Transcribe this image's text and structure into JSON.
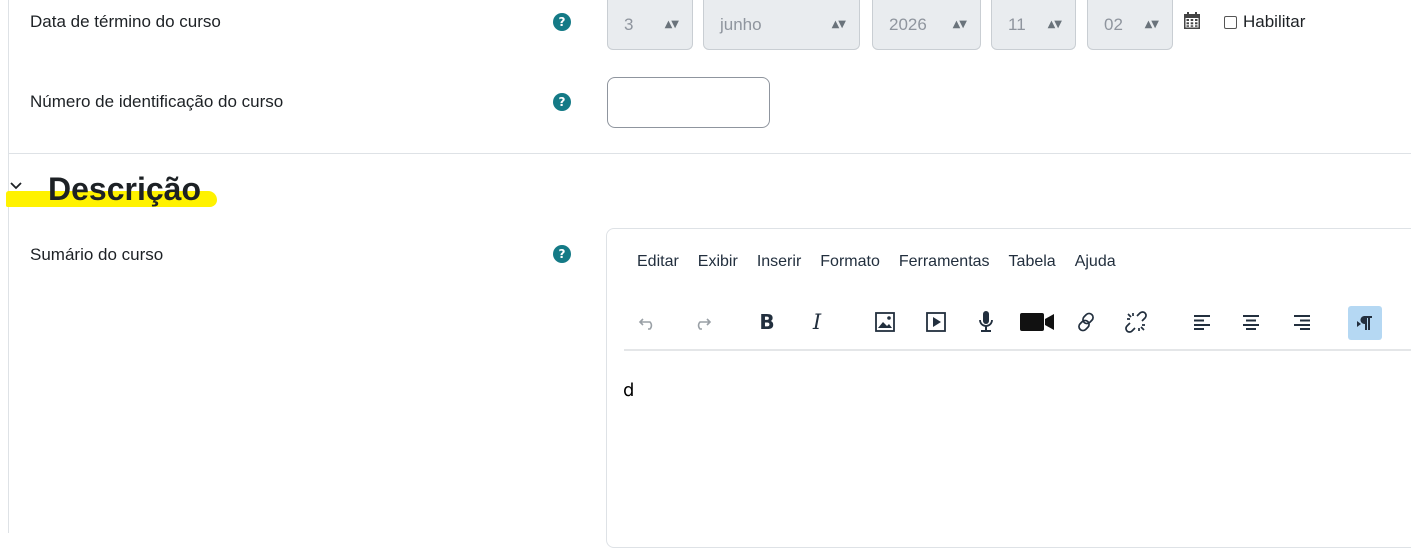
{
  "fields": {
    "end_date_label": "Data de término do curso",
    "end_date": {
      "day": "3",
      "month": "junho",
      "year": "2026",
      "hour": "11",
      "minute": "02",
      "enable_label": "Habilitar",
      "enabled": false
    },
    "idnumber_label": "Número de identificação do curso",
    "idnumber_value": ""
  },
  "section": {
    "title": "Descrição",
    "summary_label": "Sumário do curso"
  },
  "editor": {
    "menus": [
      "Editar",
      "Exibir",
      "Inserir",
      "Formato",
      "Ferramentas",
      "Tabela",
      "Ajuda"
    ],
    "toolbar": [
      "undo-icon",
      "redo-icon",
      "bold-icon",
      "italic-icon",
      "image-icon",
      "media-icon",
      "record-audio-icon",
      "record-video-icon",
      "link-icon",
      "unlink-icon",
      "align-left-icon",
      "align-center-icon",
      "align-right-icon",
      "ltr-paragraph-icon"
    ],
    "content": "d"
  },
  "colors": {
    "help_icon": "#147a86",
    "highlight": "#fff200",
    "disabled_field": "#e9ecef",
    "active_tool": "#b5d8f3"
  }
}
